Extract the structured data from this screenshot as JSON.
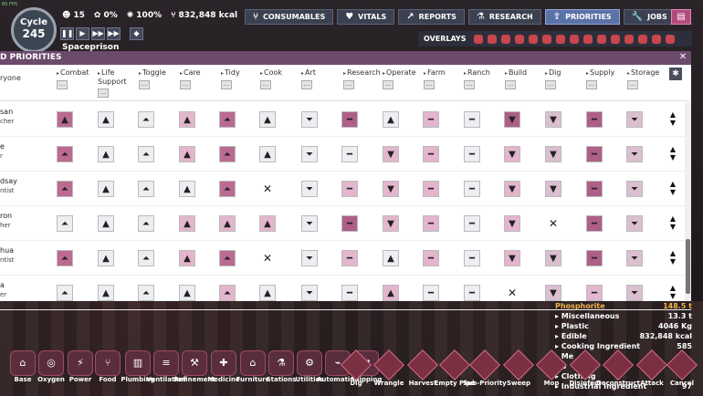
{
  "hud": {
    "fps": "60 FPS",
    "cycle_label": "Cycle",
    "cycle_number": "245",
    "duplicants": "15",
    "stress": "0%",
    "sick": "100%",
    "calories": "832,848 kcal",
    "colony": "Spaceprison",
    "top_buttons": [
      {
        "label": "CONSUMABLES",
        "icon": "fork-knife-icon"
      },
      {
        "label": "VITALS",
        "icon": "heart-icon"
      },
      {
        "label": "REPORTS",
        "icon": "chart-icon"
      },
      {
        "label": "RESEARCH",
        "icon": "flask-icon"
      },
      {
        "label": "PRIORITIES",
        "icon": "priority-icon",
        "active": true
      },
      {
        "label": "JOBS",
        "icon": "wrench-icon"
      }
    ],
    "overlays_label": "OVERLAYS"
  },
  "panel": {
    "title": "D PRIORITIES",
    "everyone": "ryone",
    "columns": [
      "Combat",
      "Life Support",
      "Toggle",
      "Care",
      "Tidy",
      "Cook",
      "Art",
      "Research",
      "Operate",
      "Farm",
      "Ranch",
      "Build",
      "Dig",
      "Supply",
      "Storage"
    ],
    "dots": "...",
    "duplicants": [
      {
        "name": "san",
        "role": "cher",
        "cells": [
          "p5-up",
          "p3-up",
          "p3-up2",
          "p4-up",
          "p5-up2",
          "p3-up",
          "p3-down2",
          "p1-dash",
          "p3-up",
          "p4-dash",
          "p3-dash",
          "p1-down",
          "p2-down",
          "p1-dash",
          "p2-down2"
        ]
      },
      {
        "name": "e",
        "role": "r",
        "cells": [
          "p5-up2",
          "p3-up",
          "p3-up2",
          "p4-up",
          "p5-up2",
          "p3-up",
          "p3-down2",
          "p3-dash",
          "p4-down",
          "p4-dash",
          "p3-dash",
          "p4-down",
          "p2-down",
          "p1-dash",
          "p2-down2"
        ]
      },
      {
        "name": "dsay",
        "role": "ntist",
        "cells": [
          "p5-up2",
          "p3-up",
          "p3-up2",
          "p3-up",
          "p5-up2",
          "x",
          "p3-down2",
          "p4-dash",
          "p4-down",
          "p4-dash",
          "p3-dash",
          "p4-down",
          "p2-down",
          "p1-dash",
          "p2-down2"
        ]
      },
      {
        "name": "ron",
        "role": "her",
        "cells": [
          "p3-up2",
          "p3-up",
          "p3-up2",
          "p4-up",
          "p4-up",
          "p4-up",
          "p3-down2",
          "p1-dash",
          "p4-down",
          "p4-dash",
          "p3-dash",
          "p4-down",
          "x",
          "p1-dash",
          "p2-down2"
        ]
      },
      {
        "name": "hua",
        "role": "ntist",
        "cells": [
          "p5-up2",
          "p3-up",
          "p3-up2",
          "p4-up",
          "p5-up2",
          "x",
          "p3-down2",
          "p4-dash",
          "p3-up",
          "p4-dash",
          "p3-dash",
          "p4-down",
          "p2-down",
          "p1-dash",
          "p2-down2"
        ]
      },
      {
        "name": "a",
        "role": "er",
        "cells": [
          "p3-up2",
          "p3-up",
          "p3-up2",
          "p3-up",
          "p4-up2",
          "p3-up",
          "p3-down2",
          "p3-dash",
          "p4-up",
          "p3-dash",
          "p3-dash",
          "x",
          "p2-down",
          "p4-dash",
          "p2-down2"
        ]
      }
    ]
  },
  "resources": [
    {
      "name": "Phosphorite",
      "value": "148.5 t",
      "highlight": true
    },
    {
      "name": "Miscellaneous",
      "value": "13.3 t"
    },
    {
      "name": "Plastic",
      "value": "4046 Kg"
    },
    {
      "name": "Edible",
      "value": "832,848 kcal"
    },
    {
      "name": "Cooking Ingredient",
      "value": "585"
    },
    {
      "name": "Me",
      "value": ""
    },
    {
      "name": "S",
      "value": ""
    },
    {
      "name": "Clothing",
      "value": ""
    },
    {
      "name": "Industrial Ingredient",
      "value": "97"
    }
  ],
  "build_tools": [
    "Base",
    "Oxygen",
    "Power",
    "Food",
    "Plumbing",
    "Ventilation",
    "Refinement",
    "Medicine",
    "Furniture",
    "Stations",
    "Utilities",
    "Automation",
    "Shipping"
  ],
  "actions": [
    "Dig",
    "Wrangle",
    "Harvest",
    "Empty Pipe",
    "Sub-Priority",
    "Sweep",
    "Mop",
    "Disinfect",
    "Deconstruct",
    "Attack",
    "Cancel"
  ]
}
